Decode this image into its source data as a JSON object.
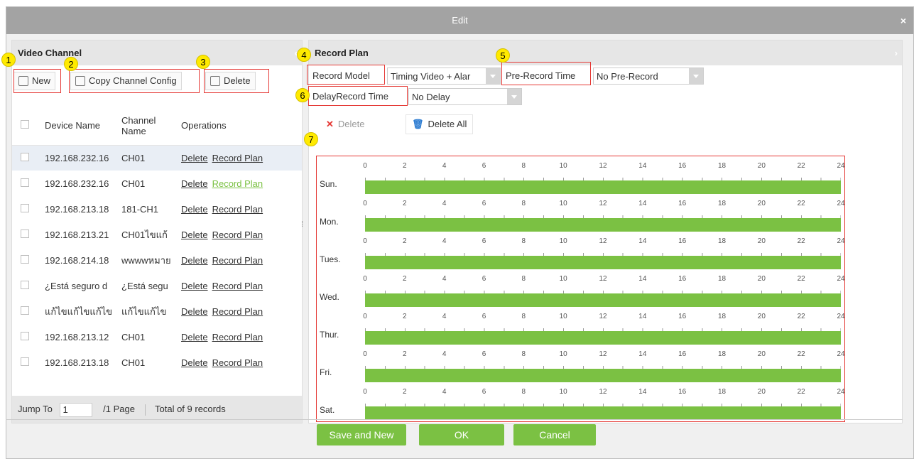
{
  "dialog": {
    "title": "Edit",
    "close": "×"
  },
  "left": {
    "title": "Video Channel",
    "buttons": {
      "new": "New",
      "copy": "Copy Channel Config",
      "delete": "Delete"
    },
    "columns": [
      "Device Name",
      "Channel Name",
      "Operations"
    ],
    "rows": [
      {
        "device": "192.168.232.16",
        "channel": "CH01",
        "op1": "Delete",
        "op2": "Record Plan"
      },
      {
        "device": "192.168.232.16",
        "channel": "CH01",
        "op1": "Delete",
        "op2": "Record Plan"
      },
      {
        "device": "192.168.213.18",
        "channel": "181-CH1",
        "op1": "Delete",
        "op2": "Record Plan"
      },
      {
        "device": "192.168.213.21",
        "channel": "CH01ไขแก้",
        "op1": "Delete",
        "op2": "Record Plan"
      },
      {
        "device": "192.168.214.18",
        "channel": "wwwwหมาย",
        "op1": "Delete",
        "op2": "Record Plan"
      },
      {
        "device": "¿Está seguro d",
        "channel": "¿Está segu",
        "op1": "Delete",
        "op2": "Record Plan"
      },
      {
        "device": "แก้ไขแก้ไขแก้ไข",
        "channel": "แก้ไขแก้ไข",
        "op1": "Delete",
        "op2": "Record Plan"
      },
      {
        "device": "192.168.213.12",
        "channel": "CH01",
        "op1": "Delete",
        "op2": "Record Plan"
      },
      {
        "device": "192.168.213.18",
        "channel": "CH01",
        "op1": "Delete",
        "op2": "Record Plan"
      }
    ],
    "pager": {
      "jump_label": "Jump To",
      "page_value": "1",
      "page_total": "/1 Page",
      "records": "Total of 9 records"
    }
  },
  "right": {
    "title": "Record Plan",
    "record_model_label": "Record Model",
    "record_model_value": "Timing Video + Alar",
    "pre_record_label": "Pre-Record Time",
    "pre_record_value": "No Pre-Record",
    "delay_label": "DelayRecord Time",
    "delay_value": "No Delay",
    "delete_btn": "Delete",
    "delete_all_btn": "Delete All",
    "days": [
      "Sun.",
      "Mon.",
      "Tues.",
      "Wed.",
      "Thur.",
      "Fri.",
      "Sat."
    ],
    "hours": [
      "0",
      "2",
      "4",
      "6",
      "8",
      "10",
      "12",
      "14",
      "16",
      "18",
      "20",
      "22",
      "24"
    ]
  },
  "badges": [
    "1",
    "2",
    "3",
    "4",
    "5",
    "6",
    "7"
  ],
  "footer": {
    "save_new": "Save and New",
    "ok": "OK",
    "cancel": "Cancel"
  },
  "colors": {
    "accent": "#7bc143",
    "highlight": "#e53935",
    "badge": "#ffea00"
  }
}
